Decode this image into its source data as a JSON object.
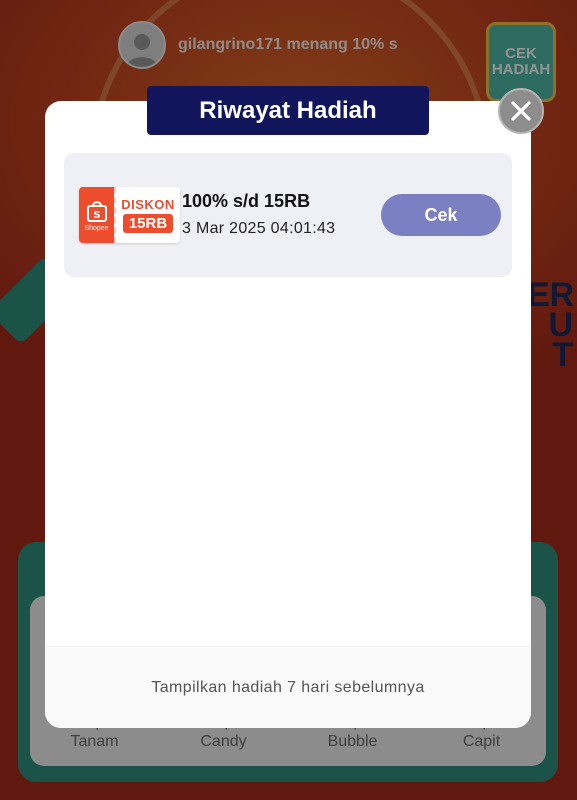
{
  "background": {
    "ticker": {
      "message": "gilangrino171 menang 10% s"
    },
    "badge": {
      "line1": "CEK",
      "line2": "HADIAH"
    },
    "side_right_text": "ER\nU\nT",
    "games": [
      {
        "label": "Tanam"
      },
      {
        "label": "Candy"
      },
      {
        "label": "Bubble"
      },
      {
        "label": "Capit"
      }
    ]
  },
  "modal": {
    "title": "Riwayat Hadiah",
    "rewards": [
      {
        "voucher_brand": "Shopee",
        "voucher_line1": "DISKON",
        "voucher_line2": "15RB",
        "name": "100% s/d 15RB",
        "date": "3 Mar 2025 04:01:43",
        "action_label": "Cek"
      }
    ],
    "footer_link": "Tampilkan hadiah 7 hari sebelumnya"
  },
  "colors": {
    "title_bg": "#11165c",
    "cek_button": "#7b80c3",
    "shopee_orange": "#ee4d2d",
    "card_bg": "#efeff6"
  }
}
